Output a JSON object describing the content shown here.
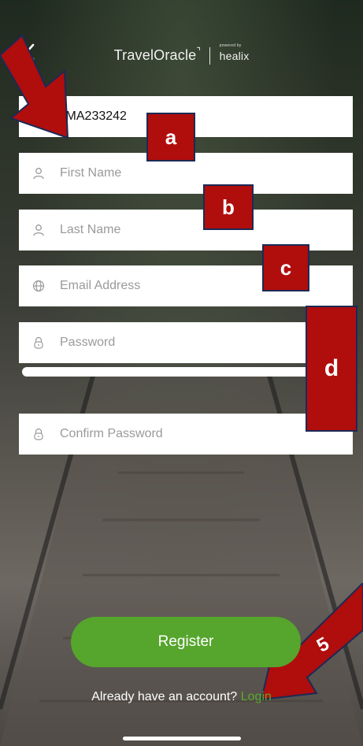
{
  "header": {
    "back_icon": "chevron-left-icon",
    "brand": "TravelOracle",
    "partner_prefix": "powered by",
    "partner": "healix"
  },
  "form": {
    "policy_number": "UMA233242",
    "first_name_placeholder": "First Name",
    "last_name_placeholder": "Last Name",
    "email_placeholder": "Email Address",
    "password_placeholder": "Password",
    "confirm_password_placeholder": "Confirm Password",
    "icons": {
      "first_name": "user-icon",
      "last_name": "user-icon",
      "email": "globe-icon",
      "password": "lock-icon",
      "confirm_password": "lock-icon"
    }
  },
  "annotations": {
    "a": "a",
    "b": "b",
    "c": "c",
    "d": "d",
    "five": "5",
    "arrow_color": "#b00d0d"
  },
  "actions": {
    "register_label": "Register",
    "login_prompt": "Already have an account?",
    "login_link": "Login"
  },
  "colors": {
    "accent_green": "#56a52d",
    "annotation_red": "#b00d0d"
  }
}
